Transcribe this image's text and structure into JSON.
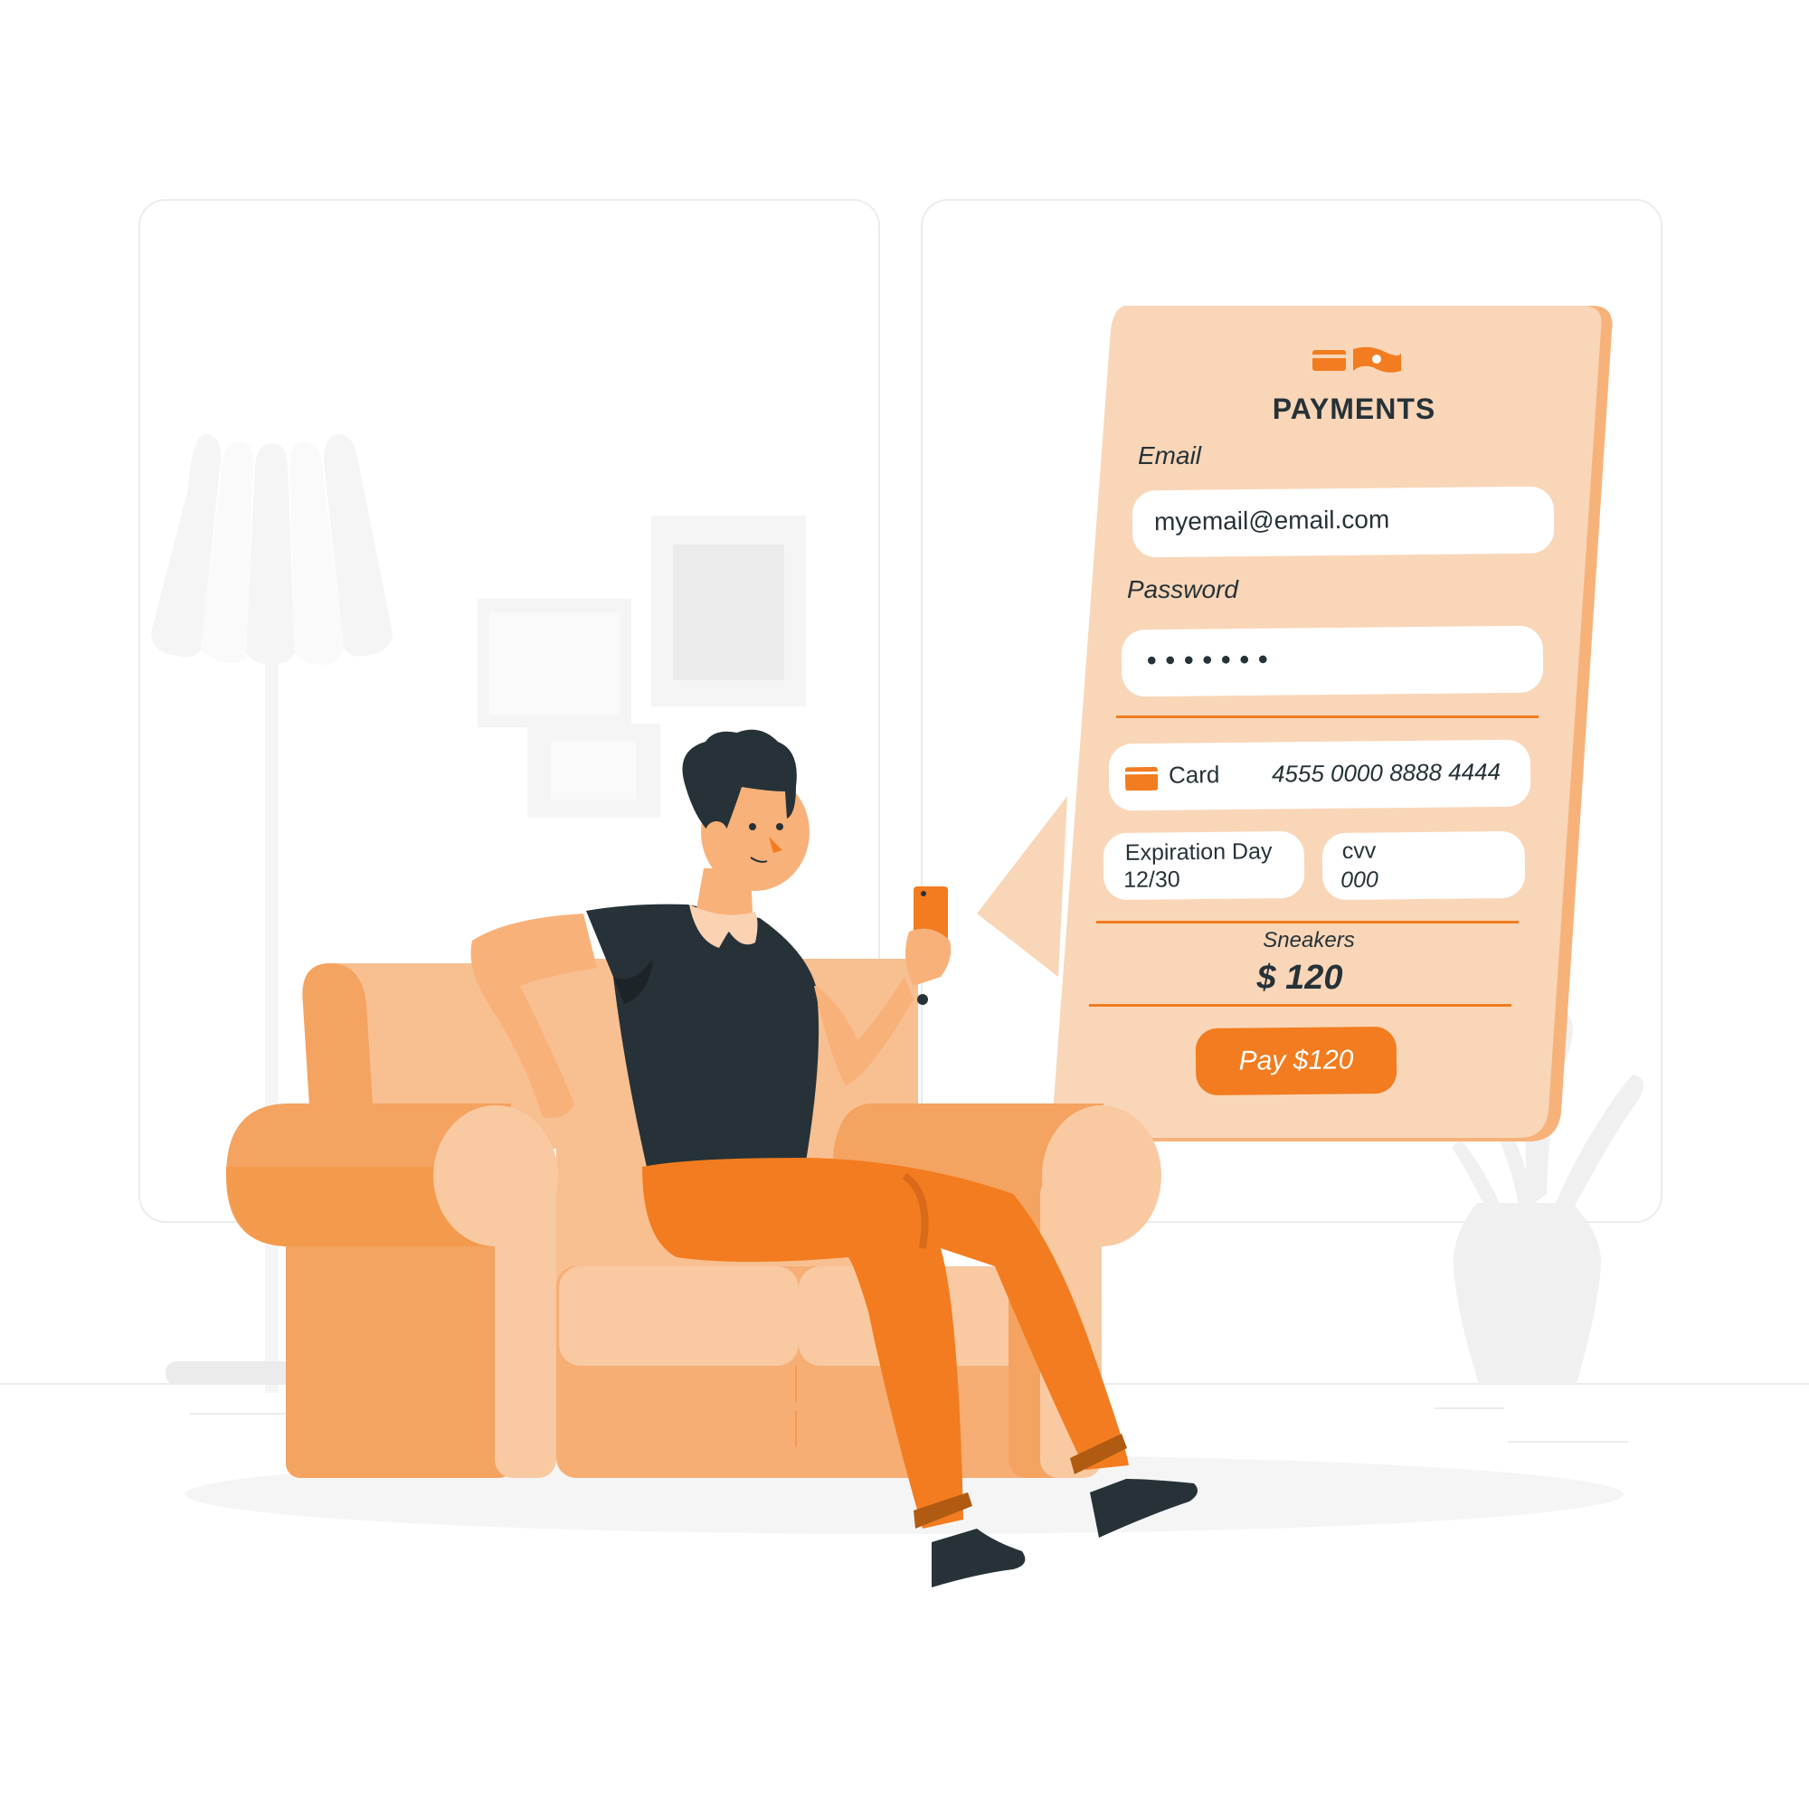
{
  "colors": {
    "accent": "#f27c1f",
    "card_bg": "#f9d6b8",
    "card_edge": "#f7b27a",
    "text_dark": "#263238",
    "sofa_light": "#f8bf91",
    "sofa_mid": "#f4a360",
    "sofa_pale": "#f9c9a2",
    "shirt": "#263238",
    "pants": "#f27c1f",
    "skin": "#f9b17a",
    "background_gray": "#f5f5f5"
  },
  "payment": {
    "icons": [
      "credit-card-icon",
      "banknote-icon"
    ],
    "title": "PAYMENTS",
    "email": {
      "label": "Email",
      "value": "myemail@email.com"
    },
    "password": {
      "label": "Password",
      "masked_value": "•••••••"
    },
    "card": {
      "icon": "credit-card-icon",
      "label": "Card",
      "number": "4555 0000 8888 4444"
    },
    "expiration": {
      "label": "Expiration Day",
      "value": "12/30"
    },
    "cvv": {
      "label": "cvv",
      "value": "000"
    },
    "product": {
      "name": "Sneakers",
      "price": "$ 120"
    },
    "pay_button_label": "Pay $120"
  },
  "scene": {
    "background_items": [
      "floor-lamp",
      "picture-frame",
      "picture-frame",
      "picture-frame",
      "potted-plant"
    ],
    "character": "person-sitting-on-sofa-holding-phone"
  }
}
